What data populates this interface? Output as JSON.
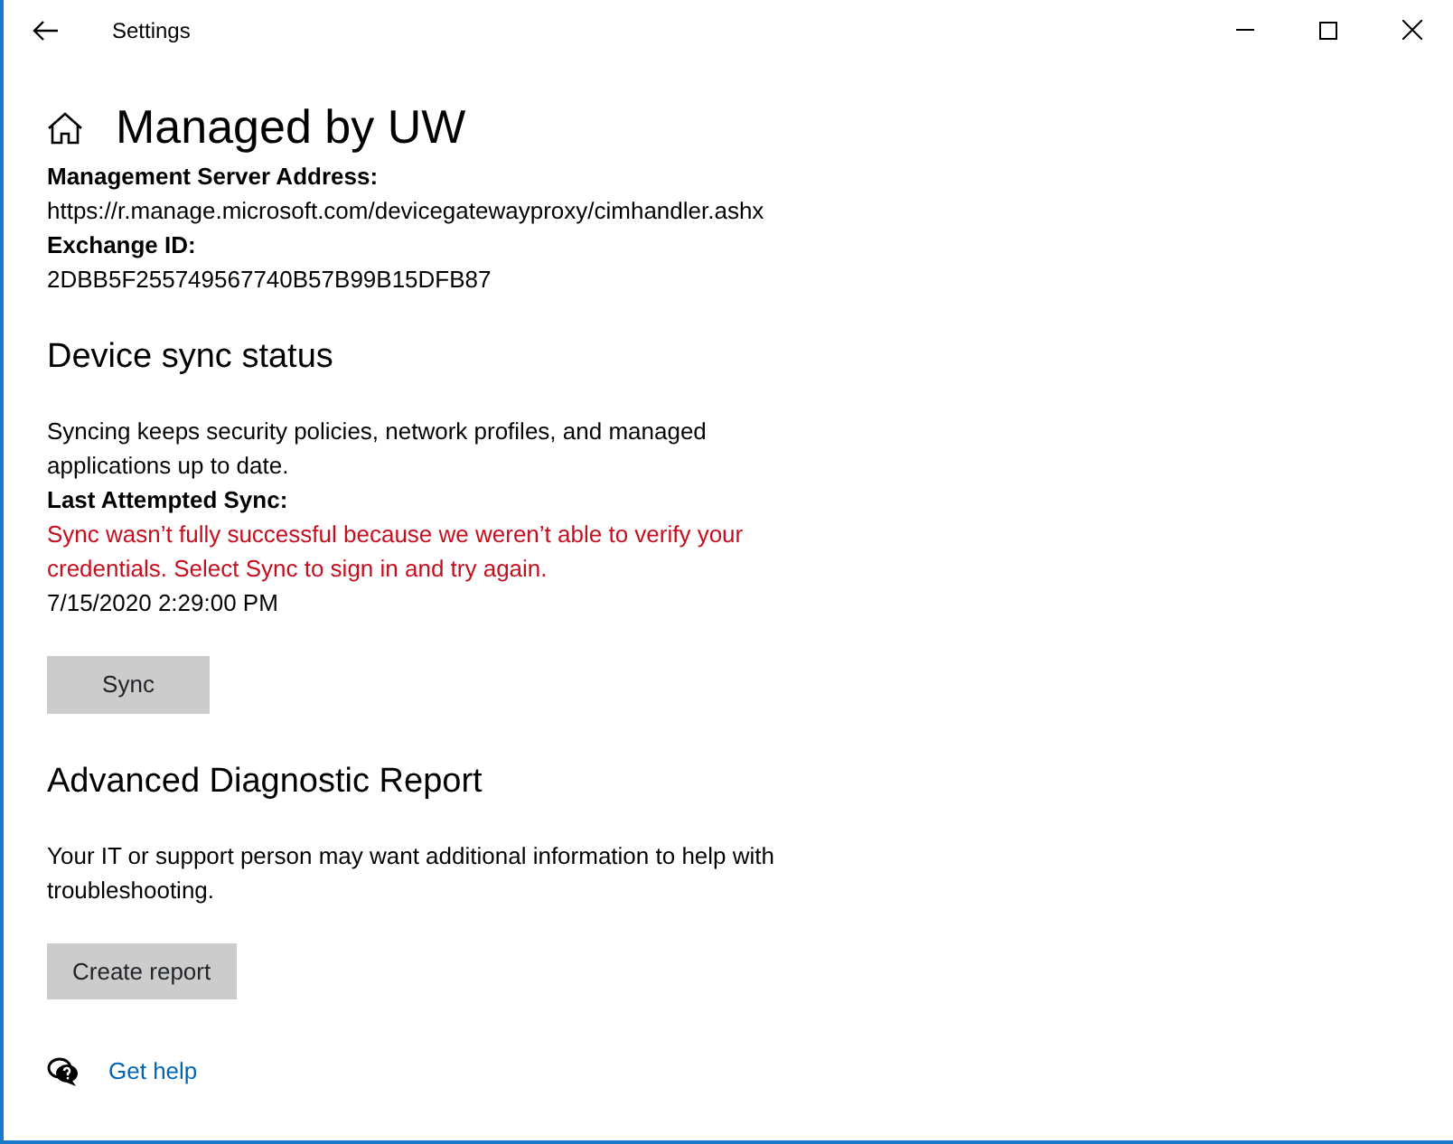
{
  "window": {
    "title": "Settings"
  },
  "page_title": "Managed by UW",
  "info": [
    {
      "kind": "label",
      "text": "Management Server Address:"
    },
    {
      "kind": "value",
      "text": "https://r.manage.microsoft.com/devicegatewayproxy/cimhandler.ashx"
    },
    {
      "kind": "label",
      "text": "Exchange ID:"
    },
    {
      "kind": "value",
      "text": "2DBB5F255749567740B57B99B15DFB87"
    }
  ],
  "sections": [
    {
      "heading": "Device sync status",
      "lines": [
        {
          "kind": "text",
          "text": "Syncing keeps security policies, network profiles, and managed applications up to date."
        },
        {
          "kind": "label",
          "text": "Last Attempted Sync:"
        },
        {
          "kind": "error",
          "text": "Sync wasn’t fully successful because we weren’t able to verify your credentials.  Select Sync to sign in and try again."
        },
        {
          "kind": "value",
          "text": "7/15/2020 2:29:00 PM"
        }
      ],
      "button": "Sync"
    },
    {
      "heading": "Advanced Diagnostic Report",
      "lines": [
        {
          "kind": "text",
          "text": "Your IT or support person may want additional information to help with troubleshooting."
        }
      ],
      "button": "Create report"
    }
  ],
  "help_link": "Get help"
}
